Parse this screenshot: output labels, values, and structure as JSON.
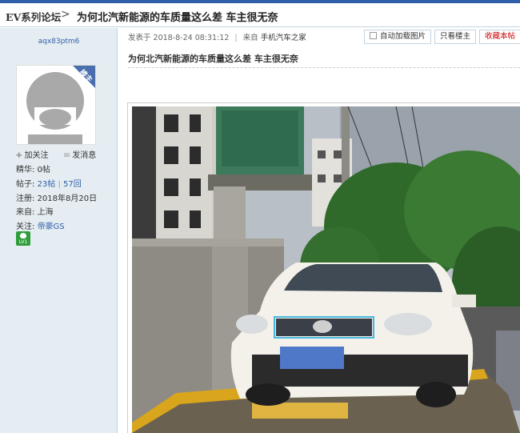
{
  "header": {
    "forum_link": "EV系列论坛",
    "separator": ">",
    "thread_title": "为何北汽新能源的车质量这么差  车主很无奈"
  },
  "author": {
    "username": "aqx83ptm6",
    "badge": "楼主",
    "actions": {
      "follow": "加关注",
      "message": "发消息"
    },
    "stats": {
      "essence": "精华: 0帖",
      "posts_label": "帖子:",
      "posts": "23帖",
      "replies": "57回",
      "registered": "注册: 2018年8月20日",
      "from": "来自: 上海",
      "interest_label": "关注:",
      "interest": "帝豪GS"
    },
    "level": "LV1"
  },
  "post": {
    "posted_label": "发表于 2018-8-24 08:31:12",
    "from_label": "来自",
    "from_app": "手机汽车之家",
    "auto_load_images": "自动加载图片",
    "only_author": "只看楼主",
    "favorite": "收藏本帖",
    "title": "为何北汽新能源的车质量这么差  车主很无奈"
  },
  "colors": {
    "accent": "#2f5fa8",
    "sidebar_bg": "#e5edf2",
    "border": "#c2d5e3",
    "badge_bg": "#4a6fb0",
    "level_bg": "#2e9e3a"
  },
  "icons": {
    "follow": "plus-icon",
    "message": "envelope-icon",
    "level": "level-badge-icon"
  }
}
